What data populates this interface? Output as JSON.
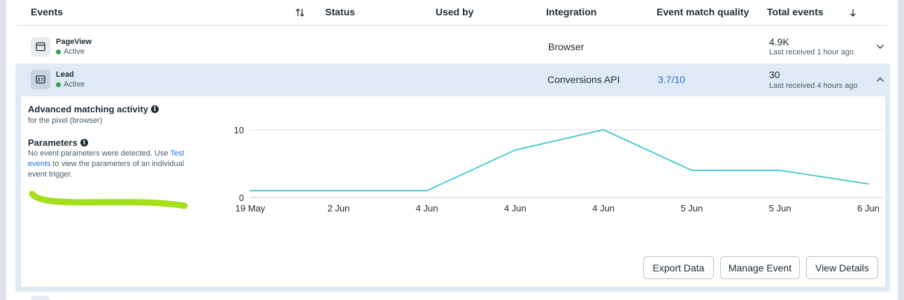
{
  "table": {
    "columns": {
      "events": "Events",
      "status": "Status",
      "used_by": "Used by",
      "integration": "Integration",
      "event_match_quality": "Event match quality",
      "total_events": "Total events"
    },
    "rows": [
      {
        "name": "PageView",
        "status": "Active",
        "integration": "Browser",
        "event_match_quality": "",
        "total": "4.9K",
        "last_received": "Last received 1 hour ago",
        "icon": "browser-window-icon",
        "expanded": false
      },
      {
        "name": "Lead",
        "status": "Active",
        "integration": "Conversions API",
        "event_match_quality": "3.7/10",
        "total": "30",
        "last_received": "Last received 4 hours ago",
        "icon": "contact-card-icon",
        "expanded": true
      }
    ]
  },
  "detail": {
    "activity_title": "Advanced matching activity",
    "activity_subtitle": "for the pixel (browser)",
    "parameters_title": "Parameters",
    "parameters_text_before": "No event parameters were detected. Use ",
    "parameters_link": "Test events",
    "parameters_text_after": " to view the parameters of an individual event trigger.",
    "buttons": {
      "export": "Export Data",
      "manage": "Manage Event",
      "view": "View Details"
    }
  },
  "chart_data": {
    "type": "line",
    "x": [
      "19 May",
      "2 Jun",
      "4 Jun",
      "4 Jun",
      "4 Jun",
      "5 Jun",
      "5 Jun",
      "6 Jun"
    ],
    "series": [
      {
        "values": [
          1,
          1,
          1,
          7,
          10,
          4,
          4,
          2
        ]
      }
    ],
    "y_ticks": [
      0,
      10
    ],
    "ylim": [
      0,
      10
    ],
    "title": "",
    "xlabel": "",
    "ylabel": "",
    "color": "#3cc8c8",
    "grid": true
  },
  "colors": {
    "accent": "#216fdb",
    "active": "#31a24c",
    "expanded_bg": "#dfeaf5",
    "highlight_stroke": "#a3e01b"
  }
}
